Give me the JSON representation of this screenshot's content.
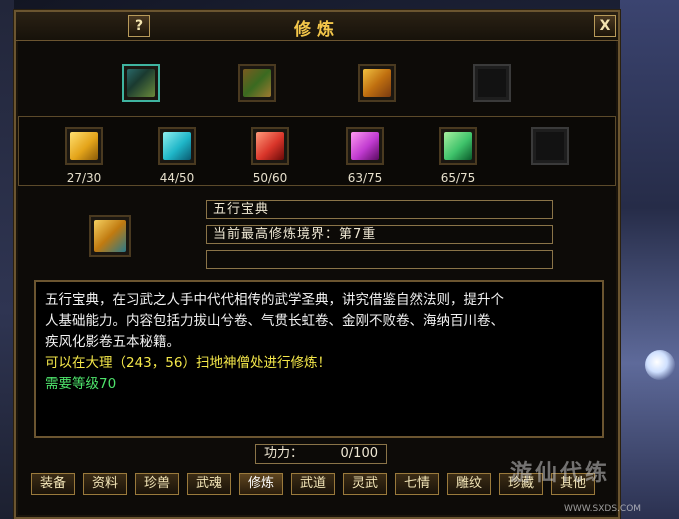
{
  "window": {
    "title": "修炼",
    "help_label": "?",
    "close_label": "X"
  },
  "top_slots": [
    {
      "icon": "book-icon",
      "empty": false
    },
    {
      "icon": "scroll-icon",
      "empty": false
    },
    {
      "icon": "treasure-icon",
      "empty": false
    },
    {
      "icon": "empty-slot",
      "empty": true
    }
  ],
  "manuals": [
    {
      "icon": "yellow-manual-icon",
      "color": "#e4a41a",
      "progress": "27/30"
    },
    {
      "icon": "cyan-manual-icon",
      "color": "#1fb6c8",
      "progress": "44/50"
    },
    {
      "icon": "red-manual-icon",
      "color": "#d9352a",
      "progress": "50/60"
    },
    {
      "icon": "purple-manual-icon",
      "color": "#c03ad0",
      "progress": "63/75"
    },
    {
      "icon": "green-manual-icon",
      "color": "#3fc36b",
      "progress": "65/75"
    },
    {
      "icon": "empty-slot",
      "color": "#222222",
      "progress": ""
    }
  ],
  "selected": {
    "icon": "five-elements-book-icon",
    "name": "五行宝典",
    "realm": "当前最高修炼境界：第7重",
    "extra": ""
  },
  "description": {
    "line1": "五行宝典，在习武之人手中代代相传的武学圣典，讲究借鉴自然法则，提升个",
    "line2": "人基础能力。内容包括力拔山兮卷、气贯长虹卷、金刚不败卷、海纳百川卷、",
    "line3": "疾风化影卷五本秘籍。",
    "location": "可以在大理（243，56）扫地神僧处进行修炼！",
    "requirement": "需要等级70"
  },
  "gongli": {
    "label": "功力：",
    "value": "0/100"
  },
  "tabs": [
    "装备",
    "资料",
    "珍兽",
    "武魂",
    "修炼",
    "武道",
    "灵武",
    "七情",
    "雕纹",
    "珍藏",
    "其他"
  ],
  "active_tab": "修炼",
  "watermark": {
    "text": "游仙代练",
    "url": "WWW.SXDS.COM"
  }
}
